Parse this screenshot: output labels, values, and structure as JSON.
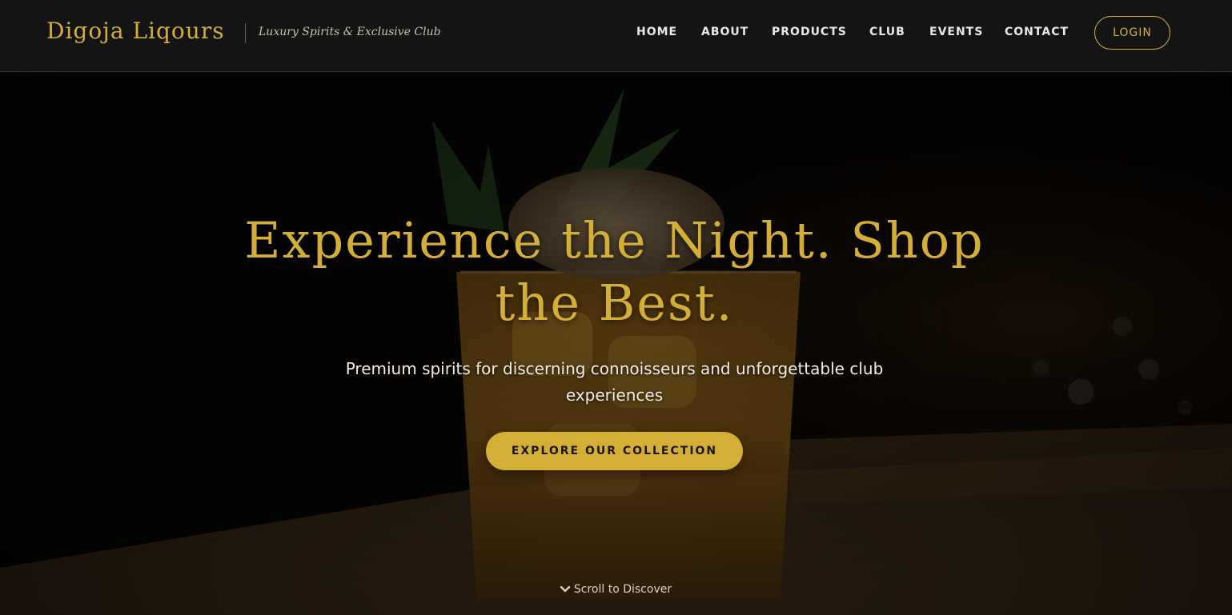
{
  "header": {
    "brand": "Digoja Liqours",
    "tagline": "Luxury Spirits & Exclusive Club",
    "nav": {
      "home": "HOME",
      "about": "ABOUT",
      "products": "PRODUCTS",
      "club": "CLUB",
      "events": "EVENTS",
      "contact": "CONTACT"
    },
    "login_label": "LOGIN"
  },
  "hero": {
    "title": "Experience the Night. Shop the Best.",
    "subtitle": "Premium spirits for discerning connoisseurs and unforgettable club experiences",
    "cta_label": "EXPLORE OUR COLLECTION",
    "scroll_label": "Scroll to Discover",
    "scroll_icon": "chevron-down-icon",
    "background_image": "cocktail-glass-photo"
  },
  "colors": {
    "accent_gold": "#d4af37",
    "header_bg": "#141414",
    "hero_bg": "#050403",
    "text_light": "#f2eee4"
  }
}
